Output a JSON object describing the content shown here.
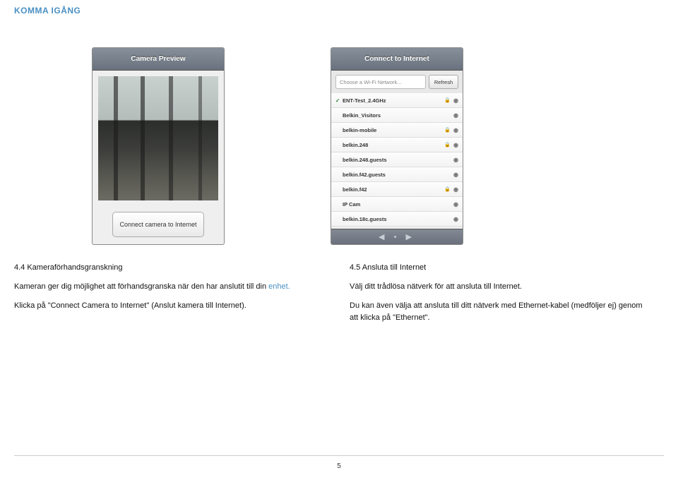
{
  "header": "KOMMA IGÅNG",
  "page_number": "5",
  "phone_left": {
    "title": "Camera Preview",
    "button": "Connect camera to Internet"
  },
  "phone_right": {
    "title": "Connect to Internet",
    "search_placeholder": "Choose a Wi-Fi Network...",
    "refresh": "Refresh",
    "networks": [
      {
        "ssid": "ENT-Test_2.4GHz",
        "locked": true,
        "checked": true
      },
      {
        "ssid": "Belkin_Visitors",
        "locked": false,
        "checked": false
      },
      {
        "ssid": "belkin-mobile",
        "locked": true,
        "checked": false
      },
      {
        "ssid": "belkin.248",
        "locked": true,
        "checked": false
      },
      {
        "ssid": "belkin.248.guests",
        "locked": false,
        "checked": false
      },
      {
        "ssid": "belkin.f42.guests",
        "locked": false,
        "checked": false
      },
      {
        "ssid": "belkin.f42",
        "locked": true,
        "checked": false
      },
      {
        "ssid": "IP Cam",
        "locked": false,
        "checked": false
      },
      {
        "ssid": "belkin.18c.guests",
        "locked": false,
        "checked": false
      }
    ]
  },
  "left_col": {
    "heading": "4.4 Kameraförhandsgranskning",
    "p1a": "Kameran ger dig möjlighet att förhandsgranska när den har anslutit till din ",
    "p1b": "enhet.",
    "p2": "Klicka på \"Connect Camera to Internet\" (Anslut kamera till Internet)."
  },
  "right_col": {
    "heading": "4.5 Ansluta till Internet",
    "p1": "Välj ditt trådlösa nätverk för att ansluta till Internet.",
    "p2": "Du kan även välja att ansluta till ditt nätverk med Ethernet-kabel (medföljer ej) genom att klicka på \"Ethernet\"."
  }
}
